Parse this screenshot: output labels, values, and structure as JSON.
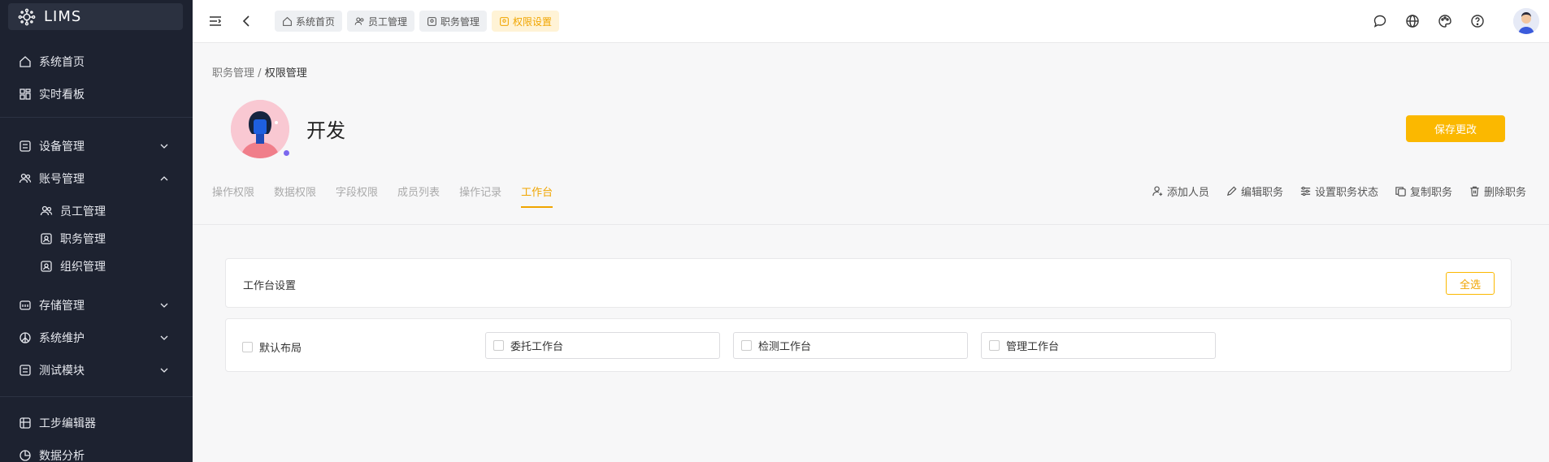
{
  "app": {
    "name": "LIMS"
  },
  "sidebar": {
    "items": [
      {
        "label": "系统首页",
        "icon": "home-icon"
      },
      {
        "label": "实时看板",
        "icon": "dashboard-icon"
      },
      {
        "label": "设备管理",
        "icon": "device-icon",
        "expanded": false
      },
      {
        "label": "账号管理",
        "icon": "users-icon",
        "expanded": true
      },
      {
        "label": "员工管理",
        "icon": "users-icon"
      },
      {
        "label": "职务管理",
        "icon": "badge-icon"
      },
      {
        "label": "组织管理",
        "icon": "badge-icon"
      },
      {
        "label": "存储管理",
        "icon": "storage-icon",
        "expanded": false
      },
      {
        "label": "系统维护",
        "icon": "peace-icon",
        "expanded": false
      },
      {
        "label": "测试模块",
        "icon": "test-icon",
        "expanded": false
      },
      {
        "label": "工步编辑器",
        "icon": "grid-icon"
      },
      {
        "label": "数据分析",
        "icon": "chart-icon"
      }
    ]
  },
  "topbar": {
    "tabs": [
      {
        "label": "系统首页",
        "active": false
      },
      {
        "label": "员工管理",
        "active": false
      },
      {
        "label": "职务管理",
        "active": false
      },
      {
        "label": "权限设置",
        "active": true
      }
    ]
  },
  "breadcrumb": {
    "parent": "职务管理",
    "separator": "/",
    "current": "权限管理"
  },
  "role": {
    "name": "开发"
  },
  "save_label": "保存更改",
  "subtabs": [
    {
      "label": "操作权限",
      "active": false
    },
    {
      "label": "数据权限",
      "active": false
    },
    {
      "label": "字段权限",
      "active": false
    },
    {
      "label": "成员列表",
      "active": false
    },
    {
      "label": "操作记录",
      "active": false
    },
    {
      "label": "工作台",
      "active": true
    }
  ],
  "actions": [
    {
      "label": "添加人员",
      "icon": "add-user-icon"
    },
    {
      "label": "编辑职务",
      "icon": "edit-icon"
    },
    {
      "label": "设置职务状态",
      "icon": "settings-sliders-icon"
    },
    {
      "label": "复制职务",
      "icon": "copy-icon"
    },
    {
      "label": "删除职务",
      "icon": "trash-icon"
    }
  ],
  "workbench": {
    "title": "工作台设置",
    "select_all": "全选",
    "options": [
      {
        "label": "默认布局",
        "checked": false
      },
      {
        "label": "委托工作台",
        "checked": false
      },
      {
        "label": "检测工作台",
        "checked": false
      },
      {
        "label": "管理工作台",
        "checked": false
      }
    ]
  },
  "colors": {
    "accent": "#fbb800",
    "sidebar_bg": "#1d2230"
  }
}
